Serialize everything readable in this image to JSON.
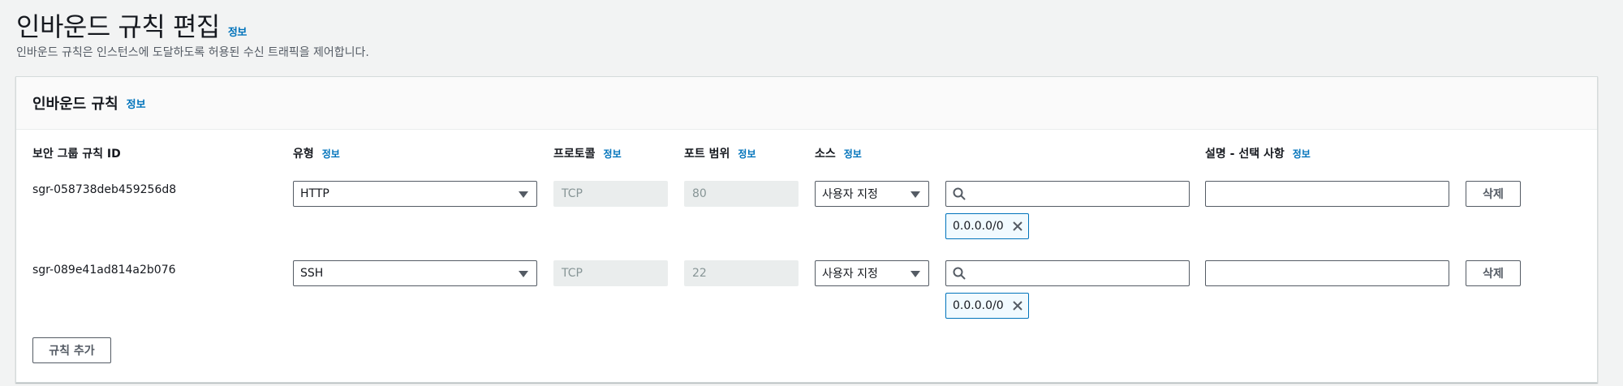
{
  "page": {
    "title": "인바운드 규칙 편집",
    "info": "정보",
    "description": "인바운드 규칙은 인스턴스에 도달하도록 허용된 수신 트래픽을 제어합니다."
  },
  "panel": {
    "title": "인바운드 규칙",
    "info": "정보"
  },
  "columns": {
    "rule_id": "보안 그룹 규칙 ID",
    "type": "유형",
    "protocol": "프로토콜",
    "port_range": "포트 범위",
    "source": "소스",
    "description": "설명 - 선택 사항",
    "info": "정보"
  },
  "rules": [
    {
      "id": "sgr-058738deb459256d8",
      "type": "HTTP",
      "protocol": "TCP",
      "port": "80",
      "source_type": "사용자 지정",
      "cidr": "0.0.0.0/0",
      "delete": "삭제"
    },
    {
      "id": "sgr-089e41ad814a2b076",
      "type": "SSH",
      "protocol": "TCP",
      "port": "22",
      "source_type": "사용자 지정",
      "cidr": "0.0.0.0/0",
      "delete": "삭제"
    }
  ],
  "add_rule": "규칙 추가",
  "icons": {
    "search": "search-icon",
    "caret": "caret-down-icon",
    "remove": "close-icon"
  },
  "colors": {
    "link": "#0073bb",
    "token_border": "#0073bb",
    "token_bg": "#f1faff",
    "page_bg": "#f2f3f3"
  }
}
